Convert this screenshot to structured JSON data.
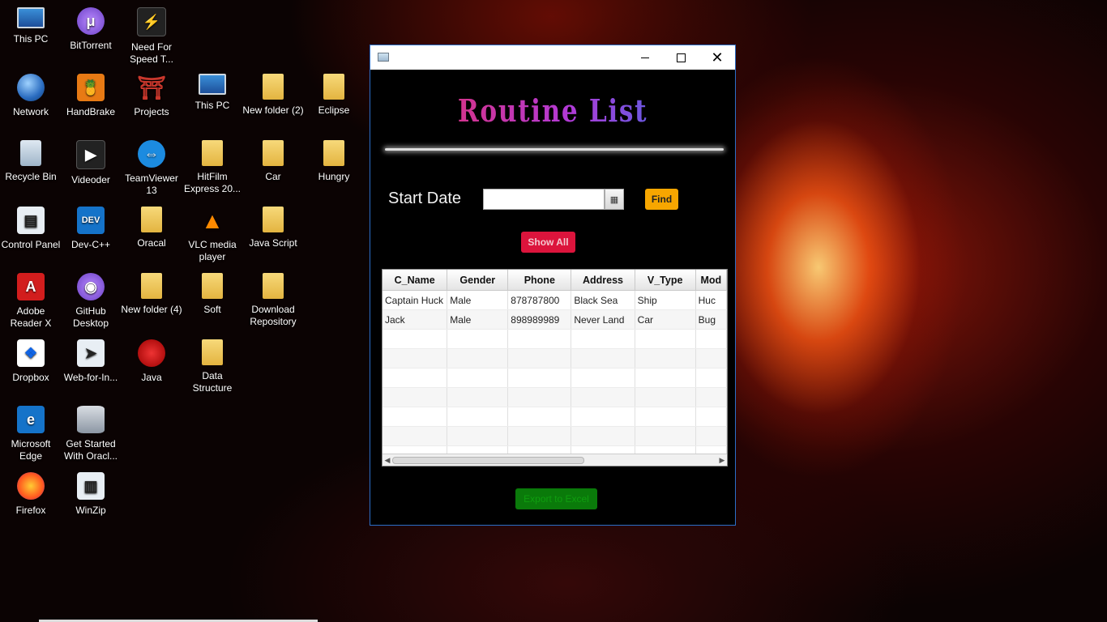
{
  "desktop": {
    "icons": [
      {
        "label": "This PC",
        "icon": "monitor-icon"
      },
      {
        "label": "BitTorrent",
        "icon": "bittorrent-icon"
      },
      {
        "label": "Need For Speed T...",
        "icon": "game-icon"
      },
      {
        "label": "Network",
        "icon": "globe-icon"
      },
      {
        "label": "HandBrake",
        "icon": "handbrake-icon"
      },
      {
        "label": "Projects",
        "icon": "torii-icon"
      },
      {
        "label": "This PC",
        "icon": "monitor-icon"
      },
      {
        "label": "New folder (2)",
        "icon": "folder-icon"
      },
      {
        "label": "Eclipse",
        "icon": "folder-icon"
      },
      {
        "label": "Recycle Bin",
        "icon": "recycle-bin-icon"
      },
      {
        "label": "Videoder",
        "icon": "videoder-icon"
      },
      {
        "label": "TeamViewer 13",
        "icon": "teamviewer-icon"
      },
      {
        "label": "HitFilm Express 20...",
        "icon": "folder-icon"
      },
      {
        "label": "Car",
        "icon": "folder-icon"
      },
      {
        "label": "Hungry",
        "icon": "folder-icon"
      },
      {
        "label": "Control Panel",
        "icon": "control-panel-icon"
      },
      {
        "label": "Dev-C++",
        "icon": "devcpp-icon"
      },
      {
        "label": "Oracal",
        "icon": "folder-icon"
      },
      {
        "label": "VLC media player",
        "icon": "vlc-icon"
      },
      {
        "label": "Java Script",
        "icon": "folder-icon"
      },
      {
        "label": "Adobe Reader X",
        "icon": "adobe-reader-icon"
      },
      {
        "label": "GitHub Desktop",
        "icon": "github-icon"
      },
      {
        "label": "New folder (4)",
        "icon": "folder-icon"
      },
      {
        "label": "Soft",
        "icon": "folder-icon"
      },
      {
        "label": "Download Repository",
        "icon": "folder-icon"
      },
      {
        "label": "Dropbox",
        "icon": "dropbox-icon"
      },
      {
        "label": "Web-for-In...",
        "icon": "web-icon"
      },
      {
        "label": "Java",
        "icon": "java-icon"
      },
      {
        "label": "Data Structure",
        "icon": "folder-icon"
      },
      {
        "label": "Microsoft Edge",
        "icon": "edge-icon"
      },
      {
        "label": "Get Started With Oracl...",
        "icon": "database-icon"
      },
      {
        "label": "Firefox",
        "icon": "firefox-icon"
      },
      {
        "label": "WinZip",
        "icon": "winzip-icon"
      }
    ]
  },
  "window": {
    "heading": "Routine List",
    "controls": {
      "minimize": "minimize",
      "maximize": "maximize",
      "close": "✕"
    },
    "start_date_label": "Start Date",
    "date_input_value": "",
    "calendar_glyph": "▦",
    "find_label": "Find",
    "show_all_label": "Show All",
    "export_label": "Export to Excel",
    "table": {
      "columns": [
        "C_Name",
        "Gender",
        "Phone",
        "Address",
        "V_Type",
        "Mod"
      ],
      "rows": [
        [
          "Captain Huck",
          "Male",
          "878787800",
          "Black Sea",
          "Ship",
          "Huc"
        ],
        [
          "Jack",
          "Male",
          "898989989",
          "Never Land",
          "Car",
          "Bug"
        ]
      ]
    }
  },
  "colors": {
    "find": "#f7a600",
    "show_all": "#dc143c",
    "export": "#0a7a0a",
    "window_border": "#2b6fc8"
  }
}
